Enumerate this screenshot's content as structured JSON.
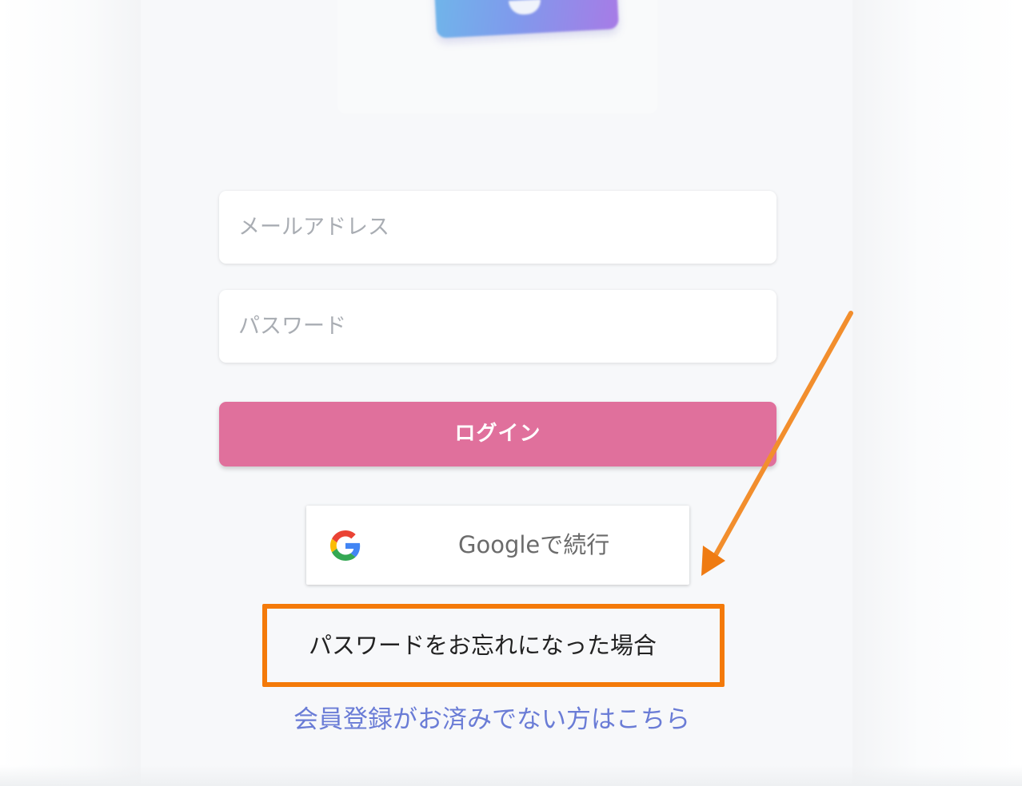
{
  "login_form": {
    "email_placeholder": "メールアドレス",
    "password_placeholder": "パスワード",
    "login_label": "ログイン"
  },
  "social": {
    "google_label": "Googleで続行"
  },
  "links": {
    "forgot_password": "パスワードをお忘れになった場合",
    "register": "会員登録がお済みでない方はこちら"
  },
  "colors": {
    "login_button": "#e0709c",
    "link": "#6a7cd6",
    "annotation": "#f47a09"
  },
  "icons": {
    "google": "google-g-icon",
    "annotation_arrow": "arrow-icon"
  }
}
